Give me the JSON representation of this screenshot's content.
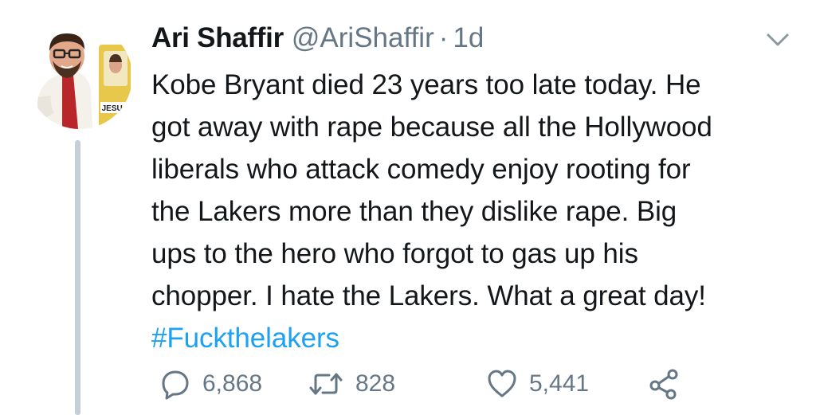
{
  "tweet": {
    "display_name": "Ari Shaffir",
    "handle": "@AriShaffir",
    "separator": "·",
    "time": "1d",
    "text_lines": [
      "Kobe Bryant died 23 years too late today. He",
      "got away with rape because all the Hollywood",
      "liberals who attack comedy enjoy rooting for",
      "the Lakers more than they dislike rape. Big",
      "ups to the hero who forgot to gas up his",
      "chopper. I hate the Lakers. What a great day!"
    ],
    "hashtag": "#Fuckthelakers",
    "avatar_badge": "JESUS"
  },
  "actions": {
    "reply_count": "6,868",
    "retweet_count": "828",
    "like_count": "5,441"
  },
  "icons": {
    "reply": "reply-icon",
    "retweet": "retweet-icon",
    "like": "heart-icon",
    "share": "share-icon",
    "menu": "chevron-down-icon"
  },
  "colors": {
    "text": "#14171a",
    "secondary": "#657786",
    "link": "#1da1f2",
    "thread_line": "#c4cfd6"
  }
}
